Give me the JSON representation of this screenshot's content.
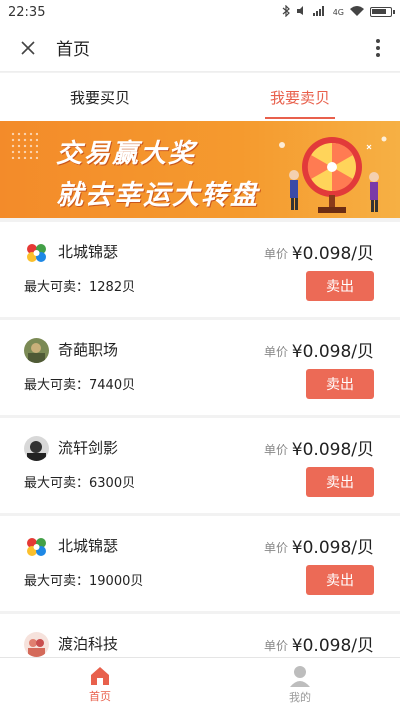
{
  "status_bar": {
    "time": "22:35",
    "icons": [
      "bluetooth-icon",
      "mute-icon",
      "signal-icon",
      "wifi-icon",
      "battery-icon"
    ],
    "network_label": "4G"
  },
  "nav": {
    "title": "首页",
    "close_icon": "close-icon",
    "more_icon": "more-vert-icon"
  },
  "tabs": [
    {
      "label": "我要买贝",
      "active": false
    },
    {
      "label": "我要卖贝",
      "active": true
    }
  ],
  "banner": {
    "line1": "交易赢大奖",
    "line2": "就去幸运大转盘",
    "background": "#f59a2e"
  },
  "listings": [
    {
      "name": "北城锦瑟",
      "price_label": "单价",
      "price": "¥0.098/贝",
      "max_label": "最大可卖：",
      "max_value": "1282贝",
      "button": "卖出",
      "avatar": "colorful-circles"
    },
    {
      "name": "奇葩职场",
      "price_label": "单价",
      "price": "¥0.098/贝",
      "max_label": "最大可卖：",
      "max_value": "7440贝",
      "button": "卖出",
      "avatar": "photo-green"
    },
    {
      "name": "流轩剑影",
      "price_label": "单价",
      "price": "¥0.098/贝",
      "max_label": "最大可卖：",
      "max_value": "6300贝",
      "button": "卖出",
      "avatar": "photo-dark"
    },
    {
      "name": "北城锦瑟",
      "price_label": "单价",
      "price": "¥0.098/贝",
      "max_label": "最大可卖：",
      "max_value": "19000贝",
      "button": "卖出",
      "avatar": "colorful-circles"
    },
    {
      "name": "渡泊科技",
      "price_label": "单价",
      "price": "¥0.098/贝",
      "max_label": "",
      "max_value": "",
      "button": "",
      "avatar": "photo-people"
    }
  ],
  "bottom_nav": [
    {
      "label": "首页",
      "icon": "home-icon",
      "active": true
    },
    {
      "label": "我的",
      "icon": "user-icon",
      "active": false
    }
  ],
  "colors": {
    "accent": "#e8604c",
    "sell_button": "#ec6a56",
    "page_bg": "#f2f2f2"
  }
}
